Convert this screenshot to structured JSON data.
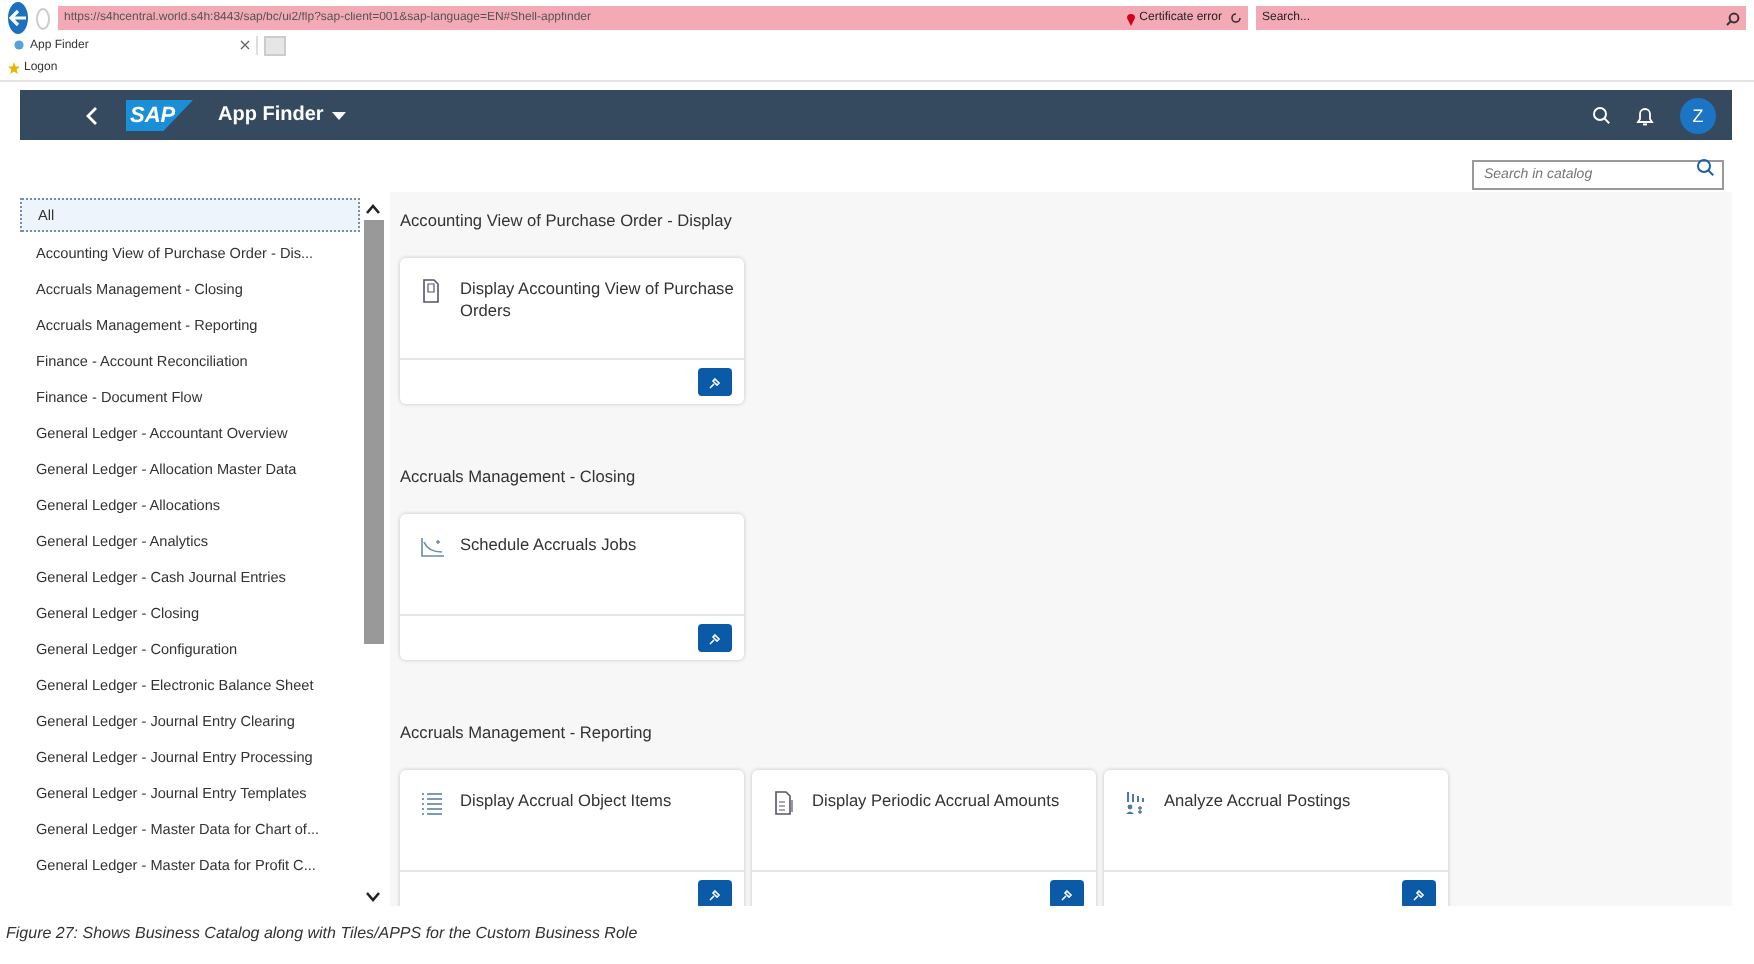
{
  "browser": {
    "url": "https://s4hcentral.world.s4h:8443/sap/bc/ui2/flp?sap-client=001&sap-language=EN#Shell-appfinder",
    "certificate": "Certificate error",
    "search_placeholder": "Search...",
    "tabs": [
      {
        "title": "App Finder",
        "selected": true
      }
    ],
    "favorites": [
      "Logon"
    ]
  },
  "shell": {
    "logo": "SAP",
    "title": "App Finder",
    "avatar": "Z"
  },
  "catalog_search": {
    "placeholder": "Search in catalog"
  },
  "sidebar": {
    "items": [
      {
        "label": "All",
        "selected": true
      },
      {
        "label": "Accounting View of Purchase Order - Dis...",
        "selected": false
      },
      {
        "label": "Accruals Management - Closing",
        "selected": false
      },
      {
        "label": "Accruals Management - Reporting",
        "selected": false
      },
      {
        "label": "Finance - Account Reconciliation",
        "selected": false
      },
      {
        "label": "Finance - Document Flow",
        "selected": false
      },
      {
        "label": "General Ledger - Accountant Overview",
        "selected": false
      },
      {
        "label": "General Ledger - Allocation Master Data",
        "selected": false
      },
      {
        "label": "General Ledger - Allocations",
        "selected": false
      },
      {
        "label": "General Ledger - Analytics",
        "selected": false
      },
      {
        "label": "General Ledger - Cash Journal Entries",
        "selected": false
      },
      {
        "label": "General Ledger - Closing",
        "selected": false
      },
      {
        "label": "General Ledger - Configuration",
        "selected": false
      },
      {
        "label": "General Ledger - Electronic Balance Sheet",
        "selected": false
      },
      {
        "label": "General Ledger - Journal Entry Clearing",
        "selected": false
      },
      {
        "label": "General Ledger - Journal Entry Processing",
        "selected": false
      },
      {
        "label": "General Ledger - Journal Entry Templates",
        "selected": false
      },
      {
        "label": "General Ledger - Master Data for Chart of...",
        "selected": false
      },
      {
        "label": "General Ledger - Master Data for Profit C...",
        "selected": false
      }
    ]
  },
  "sections": [
    {
      "title": "Accounting View of Purchase Order - Display",
      "tiles": [
        {
          "title": "Display Accounting View of Purchase Orders",
          "kind": "document"
        }
      ]
    },
    {
      "title": "Accruals Management - Closing",
      "tiles": [
        {
          "title": "Schedule Accruals Jobs",
          "kind": "chart"
        }
      ]
    },
    {
      "title": "Accruals Management - Reporting",
      "tiles": [
        {
          "title": "Display Accrual Object Items",
          "kind": "list"
        },
        {
          "title": "Display Periodic Accrual Amounts",
          "kind": "sheet"
        },
        {
          "title": "Analyze Accrual Postings",
          "kind": "analytics"
        }
      ]
    }
  ],
  "caption": "Figure 27: Shows Business Catalog along with Tiles/APPS for the Custom Business Role"
}
